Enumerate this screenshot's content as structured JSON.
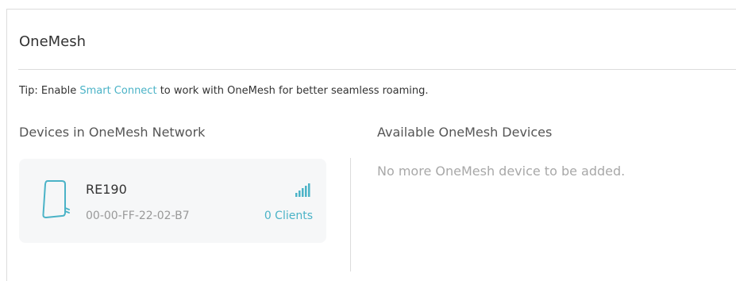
{
  "section": {
    "title": "OneMesh"
  },
  "tip": {
    "prefix": "Tip:  Enable ",
    "link": "Smart Connect",
    "suffix": " to work with OneMesh for better seamless roaming."
  },
  "devices_in_network": {
    "heading": "Devices in OneMesh Network",
    "devices": [
      {
        "name": "RE190",
        "mac": "00-00-FF-22-02-B7",
        "clients": "0 Clients",
        "icon": "extender-icon",
        "signal_icon": "signal-strength-icon"
      }
    ]
  },
  "available_devices": {
    "heading": "Available OneMesh Devices",
    "empty_message": "No more OneMesh device to be added."
  },
  "colors": {
    "accent": "#4bb3c7",
    "card_bg": "#f6f7f8",
    "muted_text": "#a8a8a8"
  }
}
